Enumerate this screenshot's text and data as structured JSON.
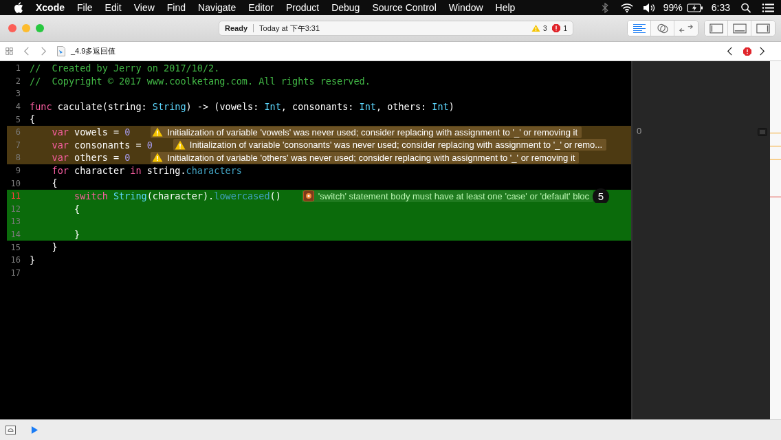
{
  "menu_bar": {
    "app": "Xcode",
    "items": [
      "File",
      "Edit",
      "View",
      "Find",
      "Navigate",
      "Editor",
      "Product",
      "Debug",
      "Source Control",
      "Window",
      "Help"
    ],
    "battery": "99%",
    "clock": "6:33"
  },
  "toolbar": {
    "status": "Ready",
    "time": "Today at 下午3:31",
    "warnings": "3",
    "errors": "1",
    "editor_modes": [
      {
        "kind": "standard",
        "selected": true
      },
      {
        "kind": "assistant",
        "selected": false
      },
      {
        "kind": "version",
        "selected": false
      }
    ],
    "panels": [
      {
        "kind": "navigator",
        "selected": false
      },
      {
        "kind": "debug",
        "selected": false
      },
      {
        "kind": "utilities",
        "selected": false
      }
    ]
  },
  "jump_bar": {
    "file": "_4.9多返回值"
  },
  "editor": {
    "lines": [
      {
        "number": "1",
        "selected": false,
        "tokens": [
          {
            "kind": "comment",
            "text": "//  Created by Jerry on 2017/10/2."
          }
        ]
      },
      {
        "number": "2",
        "selected": false,
        "tokens": [
          {
            "kind": "comment",
            "text": "//  Copyright © 2017 www.coolketang.com. All rights reserved."
          }
        ]
      },
      {
        "number": "3",
        "selected": false
      },
      {
        "number": "4",
        "selected": false,
        "tokens": [
          {
            "kind": "keyword",
            "text": "func"
          },
          {
            "kind": "plain",
            "text": " caculate(string: "
          },
          {
            "kind": "type",
            "text": "String"
          },
          {
            "kind": "plain",
            "text": ") -> (vowels: "
          },
          {
            "kind": "type",
            "text": "Int"
          },
          {
            "kind": "plain",
            "text": ", consonants: "
          },
          {
            "kind": "type",
            "text": "Int"
          },
          {
            "kind": "plain",
            "text": ", others: "
          },
          {
            "kind": "type",
            "text": "Int"
          },
          {
            "kind": "plain",
            "text": ")"
          }
        ]
      },
      {
        "number": "5",
        "selected": false,
        "tokens": [
          {
            "kind": "plain",
            "text": "{"
          }
        ]
      },
      {
        "number": "6",
        "selected": false,
        "tokens": [
          {
            "kind": "keyword",
            "text": "    var"
          },
          {
            "kind": "plain",
            "text": " vowels = "
          },
          {
            "kind": "number",
            "text": "0"
          }
        ],
        "issue": {
          "kind": "warning",
          "text": "Initialization of variable 'vowels' was never used; consider replacing with assignment to '_' or removing it"
        }
      },
      {
        "number": "7",
        "selected": false,
        "tokens": [
          {
            "kind": "keyword",
            "text": "    var"
          },
          {
            "kind": "plain",
            "text": " consonants = "
          },
          {
            "kind": "number",
            "text": "0"
          }
        ],
        "issue": {
          "kind": "warning",
          "text": "Initialization of variable 'consonants' was never used; consider replacing with assignment to '_' or remo..."
        }
      },
      {
        "number": "8",
        "selected": false,
        "tokens": [
          {
            "kind": "keyword",
            "text": "    var"
          },
          {
            "kind": "plain",
            "text": " others = "
          },
          {
            "kind": "number",
            "text": "0"
          }
        ],
        "issue": {
          "kind": "warning",
          "text": "Initialization of variable 'others' was never used; consider replacing with assignment to '_' or removing it"
        }
      },
      {
        "number": "9",
        "selected": false,
        "tokens": [
          {
            "kind": "keyword",
            "text": "    for"
          },
          {
            "kind": "plain",
            "text": " character "
          },
          {
            "kind": "keyword",
            "text": "in"
          },
          {
            "kind": "plain",
            "text": " string."
          },
          {
            "kind": "member",
            "text": "characters"
          }
        ]
      },
      {
        "number": "10",
        "selected": false,
        "tokens": [
          {
            "kind": "plain",
            "text": "    {"
          }
        ]
      },
      {
        "number": "11",
        "selected": true,
        "tokens": [
          {
            "kind": "keyword",
            "text": "        switch "
          },
          {
            "kind": "type",
            "text": "String"
          },
          {
            "kind": "plain",
            "text": "(character)."
          },
          {
            "kind": "member",
            "text": "lowercased"
          },
          {
            "kind": "plain",
            "text": "()"
          }
        ],
        "issue": {
          "kind": "error",
          "text": "'switch' statement body must have at least one 'case' or 'default' bloc",
          "count": "5"
        }
      },
      {
        "number": "12",
        "selected": true,
        "tokens": [
          {
            "kind": "plain",
            "text": "        {"
          }
        ]
      },
      {
        "number": "13",
        "selected": true
      },
      {
        "number": "14",
        "selected": true,
        "tokens": [
          {
            "kind": "plain",
            "text": "        }"
          }
        ]
      },
      {
        "number": "15",
        "selected": false,
        "tokens": [
          {
            "kind": "plain",
            "text": "    }"
          }
        ]
      },
      {
        "number": "16",
        "selected": false,
        "tokens": [
          {
            "kind": "plain",
            "text": "}"
          }
        ]
      },
      {
        "number": "17",
        "selected": false
      }
    ]
  },
  "results_panel": {
    "value": "0"
  }
}
